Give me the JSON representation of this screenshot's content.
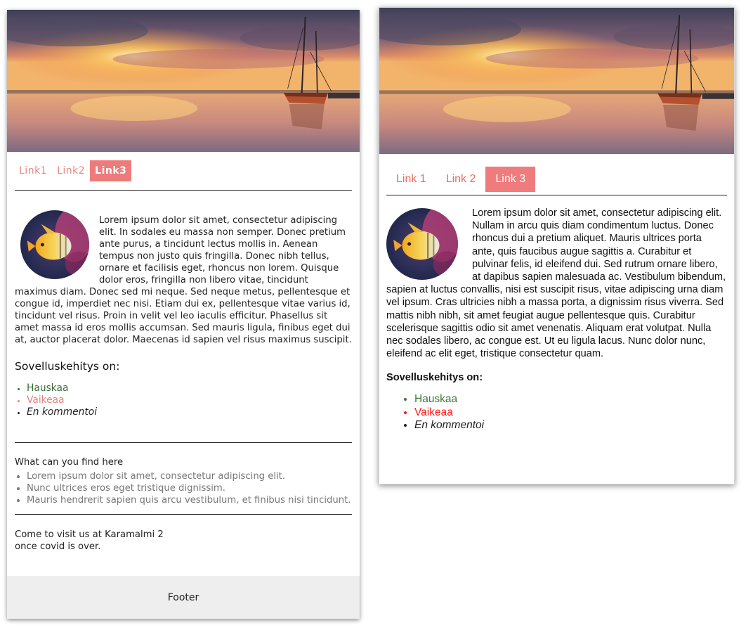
{
  "left": {
    "nav": [
      "Link1",
      "Link2",
      "Link3"
    ],
    "active_nav": 2,
    "body": "Lorem ipsum dolor sit amet, consectetur adipiscing elit. In sodales eu massa non semper. Donec pretium ante purus, a tincidunt lectus mollis in. Aenean tempus non justo quis fringilla. Donec nibh tellus, ornare et facilisis eget, rhoncus non lorem. Quisque dolor eros, fringilla non libero vitae, tincidunt maximus diam. Donec sed mi neque. Sed neque metus, pellentesque et congue id, imperdiet nec nisi. Etiam dui ex, pellentesque vitae varius id, tincidunt vel risus. Proin in velit vel leo iaculis efficitur. Phasellus sit amet massa id eros mollis accumsan. Sed mauris ligula, finibus eget dui at, auctor placerat dolor. Maecenas id sapien vel risus maximus suscipit.",
    "heading": "Sovelluskehitys on:",
    "dev_list": [
      "Hauskaa",
      "Vaikeaa",
      "En kommentoi"
    ],
    "find_title": "What can you find here",
    "find_list": [
      "Lorem ipsum dolor sit amet, consectetur adipiscing elit.",
      "Nunc ultrices eros eget tristique dignissim.",
      "Mauris hendrerit sapien quis arcu vestibulum, et finibus nisi tincidunt."
    ],
    "visit_line1": "Come to visit us at Karamalmi 2",
    "visit_line2": "once covid is over.",
    "footer": "Footer"
  },
  "right": {
    "nav": [
      "Link 1",
      "Link 2",
      "Link 3"
    ],
    "active_nav": 2,
    "body": "Lorem ipsum dolor sit amet, consectetur adipiscing elit. Nullam in arcu quis diam condimentum luctus. Donec rhoncus dui a pretium aliquet. Mauris ultrices porta ante, quis faucibus augue sagittis a. Curabitur et pulvinar felis, id eleifend dui. Sed rutrum ornare libero, at dapibus sapien malesuada ac. Vestibulum bibendum, sapien at luctus convallis, nisi est suscipit risus, vitae adipiscing urna diam vel ipsum. Cras ultricies nibh a massa porta, a dignissim risus viverra. Sed mattis nibh nibh, sit amet feugiat augue pellentesque quis. Curabitur scelerisque sagittis odio sit amet venenatis. Aliquam erat volutpat. Nulla nec sodales libero, ac congue est. Ut eu ligula lacus. Nunc dolor nunc, eleifend ac elit eget, tristique consectetur quam.",
    "heading": "Sovelluskehitys on:",
    "dev_list": [
      "Hauskaa",
      "Vaikeaa",
      "En kommentoi"
    ]
  },
  "colors": {
    "left_accent": "#ee7b7b",
    "right_accent": "#ef7b7d",
    "hauskaa_green": "#3a6b3a",
    "vaikeaa_pink": "#ea7f7f",
    "vaikeaa_red": "#ff1a1a",
    "footer_bg": "#eeeeee"
  }
}
